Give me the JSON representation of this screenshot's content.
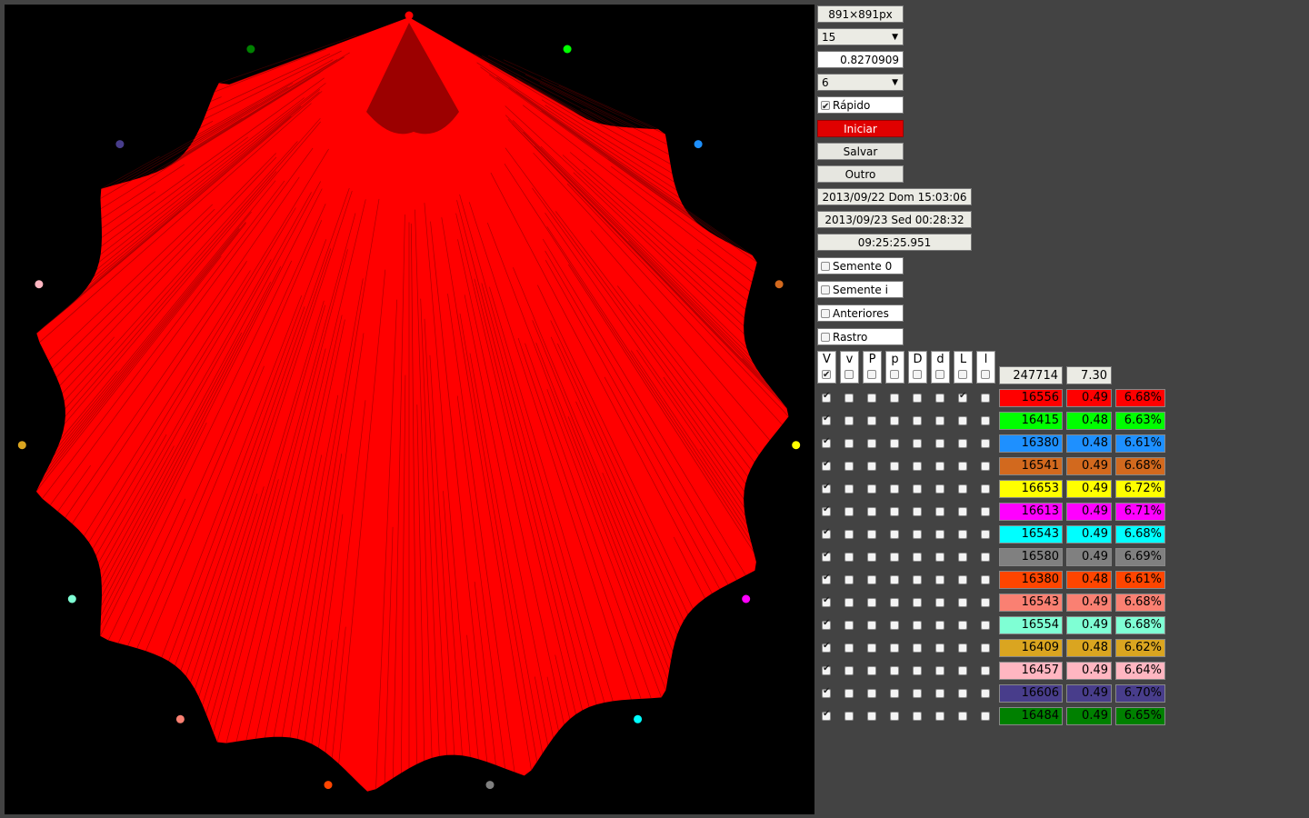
{
  "canvas": {
    "background": "#000000",
    "fan_color": "#ff0000"
  },
  "controls": {
    "size_label": "891×891px",
    "points_select": "15",
    "ratio_value": "0.8270909",
    "sides_select": "6",
    "fast_label": "Rápido",
    "fast_checked": true,
    "start_label": "Iniciar",
    "save_label": "Salvar",
    "other_label": "Outro",
    "start_time": "2013/09/22 Dom 15:03:06",
    "end_time": "2013/09/23 Sed 00:28:32",
    "elapsed": "09:25:25.951",
    "seed0_label": "Semente 0",
    "seedi_label": "Semente i",
    "previous_label": "Anteriores",
    "trail_label": "Rastro"
  },
  "table": {
    "headers": [
      "V",
      "v",
      "P",
      "p",
      "D",
      "d",
      "L",
      "l"
    ],
    "header_checked": [
      true,
      false,
      false,
      false,
      false,
      false,
      false,
      false
    ],
    "total_count": "247714",
    "total_value": "7.30",
    "rows": [
      {
        "color": "#ff0000",
        "text_color": "#000000",
        "count": "16556",
        "ratio": "0.49",
        "pct": "6.68%",
        "checks": [
          true,
          false,
          false,
          false,
          false,
          false,
          true,
          false
        ]
      },
      {
        "color": "#00ff00",
        "text_color": "#000000",
        "count": "16415",
        "ratio": "0.48",
        "pct": "6.63%",
        "checks": [
          true,
          false,
          false,
          false,
          false,
          false,
          false,
          false
        ]
      },
      {
        "color": "#1e90ff",
        "text_color": "#000000",
        "count": "16380",
        "ratio": "0.48",
        "pct": "6.61%",
        "checks": [
          true,
          false,
          false,
          false,
          false,
          false,
          false,
          false
        ]
      },
      {
        "color": "#d2691e",
        "text_color": "#000000",
        "count": "16541",
        "ratio": "0.49",
        "pct": "6.68%",
        "checks": [
          true,
          false,
          false,
          false,
          false,
          false,
          false,
          false
        ]
      },
      {
        "color": "#ffff00",
        "text_color": "#000000",
        "count": "16653",
        "ratio": "0.49",
        "pct": "6.72%",
        "checks": [
          true,
          false,
          false,
          false,
          false,
          false,
          false,
          false
        ]
      },
      {
        "color": "#ff00ff",
        "text_color": "#000000",
        "count": "16613",
        "ratio": "0.49",
        "pct": "6.71%",
        "checks": [
          true,
          false,
          false,
          false,
          false,
          false,
          false,
          false
        ]
      },
      {
        "color": "#00ffff",
        "text_color": "#000000",
        "count": "16543",
        "ratio": "0.49",
        "pct": "6.68%",
        "checks": [
          true,
          false,
          false,
          false,
          false,
          false,
          false,
          false
        ]
      },
      {
        "color": "#808080",
        "text_color": "#000000",
        "count": "16580",
        "ratio": "0.49",
        "pct": "6.69%",
        "checks": [
          true,
          false,
          false,
          false,
          false,
          false,
          false,
          false
        ]
      },
      {
        "color": "#ff4500",
        "text_color": "#000000",
        "count": "16380",
        "ratio": "0.48",
        "pct": "6.61%",
        "checks": [
          true,
          false,
          false,
          false,
          false,
          false,
          false,
          false
        ]
      },
      {
        "color": "#fa8072",
        "text_color": "#000000",
        "count": "16543",
        "ratio": "0.49",
        "pct": "6.68%",
        "checks": [
          true,
          false,
          false,
          false,
          false,
          false,
          false,
          false
        ]
      },
      {
        "color": "#7fffd4",
        "text_color": "#000000",
        "count": "16554",
        "ratio": "0.49",
        "pct": "6.68%",
        "checks": [
          true,
          false,
          false,
          false,
          false,
          false,
          false,
          false
        ]
      },
      {
        "color": "#daa520",
        "text_color": "#000000",
        "count": "16409",
        "ratio": "0.48",
        "pct": "6.62%",
        "checks": [
          true,
          false,
          false,
          false,
          false,
          false,
          false,
          false
        ]
      },
      {
        "color": "#ffb6c1",
        "text_color": "#000000",
        "count": "16457",
        "ratio": "0.49",
        "pct": "6.64%",
        "checks": [
          true,
          false,
          false,
          false,
          false,
          false,
          false,
          false
        ]
      },
      {
        "color": "#483d8b",
        "text_color": "#000000",
        "count": "16606",
        "ratio": "0.49",
        "pct": "6.70%",
        "checks": [
          true,
          false,
          false,
          false,
          false,
          false,
          false,
          false
        ]
      },
      {
        "color": "#008000",
        "text_color": "#000000",
        "count": "16484",
        "ratio": "0.49",
        "pct": "6.65%",
        "checks": [
          true,
          false,
          false,
          false,
          false,
          false,
          false,
          false
        ]
      }
    ]
  }
}
